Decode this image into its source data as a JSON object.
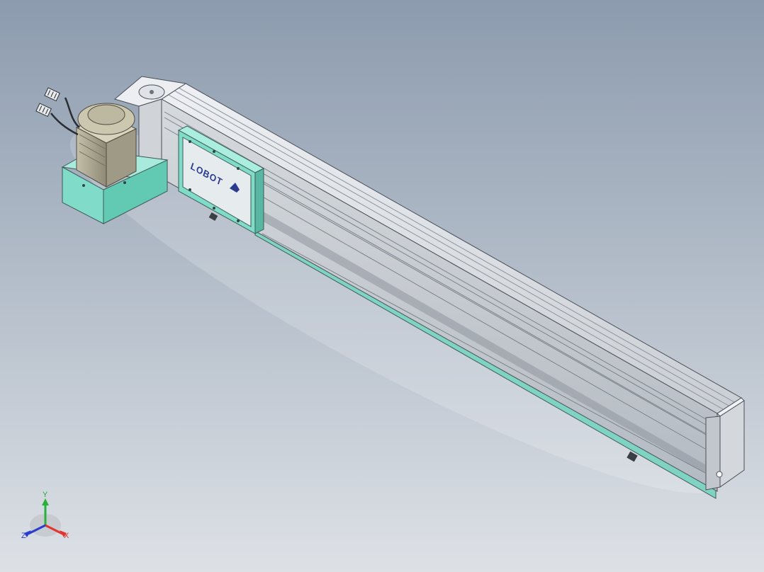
{
  "viewport": {
    "background_top": "#8c9bae",
    "background_bottom": "#dde1e6"
  },
  "model": {
    "carriage_logo_text": "LOBOT",
    "colors": {
      "profile_light": "#e3e6ea",
      "profile_mid": "#c5cad1",
      "profile_dark": "#9aa1aa",
      "carriage": "#7fdcc8",
      "carriage_dark": "#58b7a3",
      "motor_body": "#b2ad98",
      "motor_dark": "#8d8876",
      "logo": "#2b3b8f"
    }
  },
  "triad": {
    "x_label": "X",
    "y_label": "Y",
    "z_label": "Z",
    "x_color": "#e3342f",
    "y_color": "#27b13a",
    "z_color": "#2b3bd0"
  }
}
